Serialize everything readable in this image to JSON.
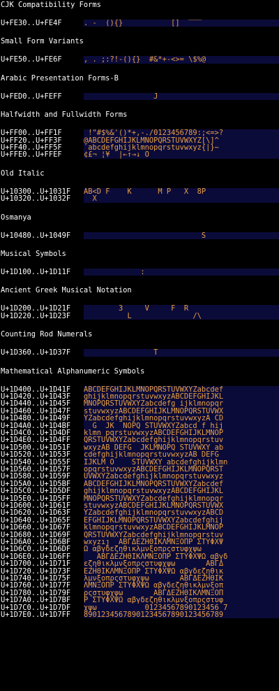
{
  "sections": [
    {
      "title": "CJK Compatibility Forms",
      "rows": [
        {
          "range": "U+FE30..U+FE4F",
          "glyphs": ". -__(){}           []  ‾‾‾___"
        }
      ]
    },
    {
      "title": "Small Form Variants",
      "rows": [
        {
          "range": "U+FE50..U+FE6F",
          "glyphs": ", . ;:?!-(){}  #&*+-<>= \\$%@"
        }
      ]
    },
    {
      "title": "Arabic Presentation Forms-B",
      "rows": [
        {
          "range": "U+FED0..U+FEFF",
          "glyphs": "                J"
        }
      ]
    },
    {
      "title": "Halfwidth and Fullwidth Forms",
      "rows": [
        {
          "range": "U+FF00..U+FF1F",
          "glyphs": " !\"#$%&'()*+,-./0123456789:;<=>?"
        },
        {
          "range": "U+FF20..U+FF3F",
          "glyphs": "@ABCDEFGHIJKLMNOPQRSTUVWXYZ[\\]^_"
        },
        {
          "range": "U+FF40..U+FF5F",
          "glyphs": "`abcdefghijklmnopqrstuvwxyz{|}~"
        },
        {
          "range": "U+FFE0..U+FFEF",
          "glyphs": "¢£¬ ¦¥  |←↑→↓ O"
        }
      ]
    },
    {
      "title": "Old Italic",
      "rows": [
        {
          "range": "U+10300..U+1031F",
          "glyphs": "AB<D F    K      M P   X  8P"
        },
        {
          "range": "U+10320..U+1032F",
          "glyphs": "  X"
        }
      ]
    },
    {
      "title": "Osmanya",
      "rows": [
        {
          "range": "U+10480..U+1049F",
          "glyphs": "                           S"
        }
      ]
    },
    {
      "title": "Musical Symbols",
      "rows": [
        {
          "range": "U+1D100..U+1D11F",
          "glyphs": "             :"
        }
      ]
    },
    {
      "title": "Ancient Greek Musical Notation",
      "rows": [
        {
          "range": "U+1D200..U+1D21F",
          "glyphs": "        3     V     F  R"
        },
        {
          "range": "U+1D220..U+1D23F",
          "glyphs": "          L              /\\"
        }
      ]
    },
    {
      "title": "Counting Rod Numerals",
      "rows": [
        {
          "range": "U+1D360..U+1D37F",
          "glyphs": "                T"
        }
      ]
    },
    {
      "title": "Mathematical Alphanumeric Symbols",
      "rows": [
        {
          "range": "U+1D400..U+1D41F",
          "glyphs": "ABCDEFGHIJKLMNOPQRSTUVWXYZabcdef"
        },
        {
          "range": "U+1D420..U+1D43F",
          "glyphs": "ghijklmnopqrstuvwxyzABCDEFGHIJKL"
        },
        {
          "range": "U+1D440..U+1D45F",
          "glyphs": "MNOPQRSTUVWXYZabcdefg ijklmnopqr"
        },
        {
          "range": "U+1D460..U+1D47F",
          "glyphs": "stuvwxyzABCDEFGHIJKLMNOPQRSTUVWX"
        },
        {
          "range": "U+1D480..U+1D49F",
          "glyphs": "YZabcdefghijklmnopqrstuvwxyzA CD"
        },
        {
          "range": "U+1D4A0..U+1D4BF",
          "glyphs": "  G  JK  NOPQ STUVWXYZabcd f hij"
        },
        {
          "range": "U+1D4C0..U+1D4DF",
          "glyphs": "klmn pqrstuvwxyzABCDEFGHIJKLMNOP"
        },
        {
          "range": "U+1D4E0..U+1D4FF",
          "glyphs": "QRSTUVWXYZabcdefghijklmnopqrstuv"
        },
        {
          "range": "U+1D500..U+1D51F",
          "glyphs": "wxyzAB DEFG  JKLMNOPQ STUVWXY ab"
        },
        {
          "range": "U+1D520..U+1D53F",
          "glyphs": "cdefghijklmnopqrstuvwxyzAB DEFG"
        },
        {
          "range": "U+1D540..U+1D55F",
          "glyphs": "IJKLM O    STUVWXY abcdefghijklmn"
        },
        {
          "range": "U+1D560..U+1D57F",
          "glyphs": "opqrstuvwxyzABCDEFGHIJKLMNOPQRST"
        },
        {
          "range": "U+1D580..U+1D59F",
          "glyphs": "UVWXYZabcdefghijklmnopqrstuvwxyz"
        },
        {
          "range": "U+1D5A0..U+1D5BF",
          "glyphs": "ABCDEFGHIJKLMNOPQRSTUVWXYZabcdef"
        },
        {
          "range": "U+1D5C0..U+1D5DF",
          "glyphs": "ghijklmnopqrstuvwxyzABCDEFGHIJKL"
        },
        {
          "range": "U+1D5E0..U+1D5FF",
          "glyphs": "MNOPQRSTUVWXYZabcdefghijklmnopqr"
        },
        {
          "range": "U+1D600..U+1D61F",
          "glyphs": "stuvwxyzABCDEFGHIJKLMNOPQRSTUVWX"
        },
        {
          "range": "U+1D620..U+1D63F",
          "glyphs": "YZabcdefghijklmnopqrstuvwxyzABCD"
        },
        {
          "range": "U+1D640..U+1D65F",
          "glyphs": "EFGHIJKLMNOPQRSTUVWXYZabcdefghij"
        },
        {
          "range": "U+1D660..U+1D67F",
          "glyphs": "klmnopqrstuvwxyzABCDEFGHIJKLMNOP"
        },
        {
          "range": "U+1D680..U+1D69F",
          "glyphs": "QRSTUVWXYZabcdefghijklmnopqrstuv"
        },
        {
          "range": "U+1D6A0..U+1D6BF",
          "glyphs": "wxyzıȷ  ΑΒΓΔΕΖΗΘΙΚΛΜΝΞΟΠΡ ΣΤΥΦΧΨ"
        },
        {
          "range": "U+1D6C0..U+1D6DF",
          "glyphs": "Ω αβγδεζηθικλμνξοπρςστυφχψω"
        },
        {
          "range": "U+1D6E0..U+1D6FF",
          "glyphs": "   ΑΒΓΔΕΖΗΘΙΚΛΜΝΞΟΠΡ ΣΤΥΦΧΨΩ αβγδ"
        },
        {
          "range": "U+1D700..U+1D71F",
          "glyphs": "εζηθικλμνξοπρςστυφχψω       ΑΒΓΔ"
        },
        {
          "range": "U+1D720..U+1D73F",
          "glyphs": "ΕΖΗΘΙΚΛΜΝΞΟΠΡ ΣΤΥΦΧΨΩ αβγδεζηθικ"
        },
        {
          "range": "U+1D740..U+1D75F",
          "glyphs": "λμνξοπρςστυφχψω       ΑΒΓΔΕΖΗΘΙΚ"
        },
        {
          "range": "U+1D760..U+1D77F",
          "glyphs": "ΛΜΝΞΟΠΡ ΣΤΥΦΧΨΩ αβγδεζηθικλμνξοπ"
        },
        {
          "range": "U+1D780..U+1D79F",
          "glyphs": "ρςστυφχψω       ΑΒΓΔΕΖΗΘΙΚΛΜΝΞΟΠ"
        },
        {
          "range": "U+1D7A0..U+1D7BF",
          "glyphs": "Ρ ΣΤΥΦΧΨΩ αβγδεζηθικλμνξοπρςστυφ"
        },
        {
          "range": "U+1D7C0..U+1D7DF",
          "glyphs": "χψω           01234567890123456 7"
        },
        {
          "range": "U+1D7E0..U+1D7FF",
          "glyphs": "89012345678901234567890123456789"
        }
      ]
    }
  ]
}
